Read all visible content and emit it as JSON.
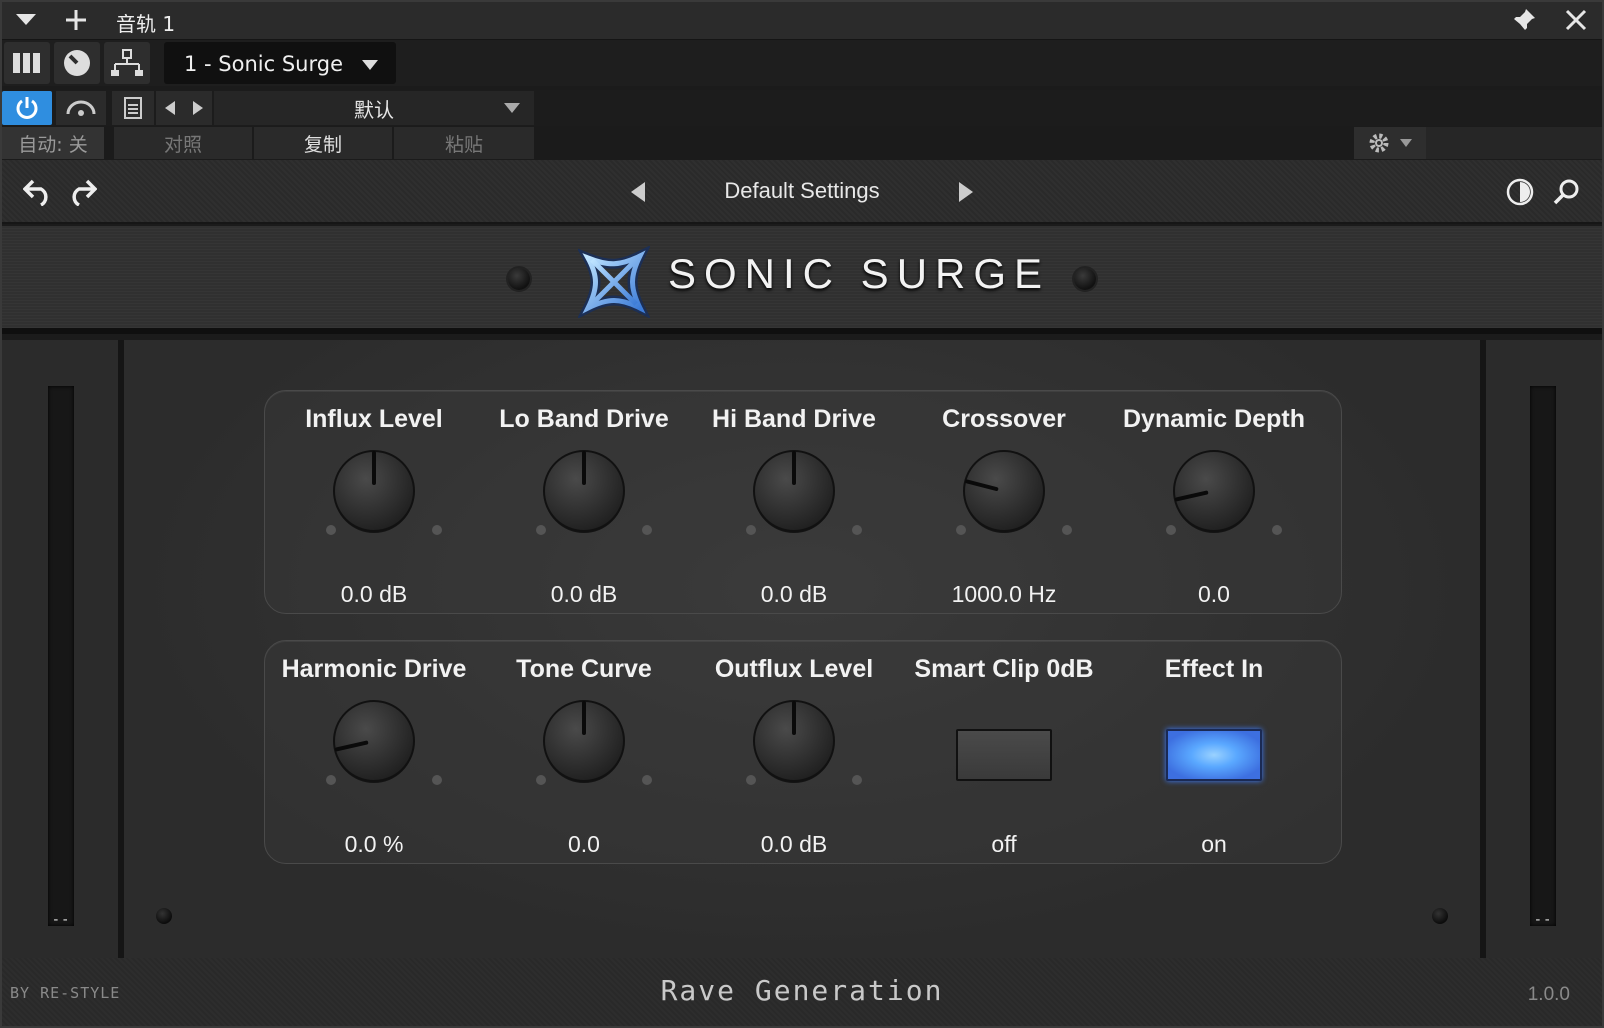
{
  "host": {
    "track_name": "音轨 1",
    "plugin_select": "1 - Sonic Surge",
    "preset_dropdown": "默认",
    "automation": "自动: 关",
    "compare": "对照",
    "copy": "复制",
    "paste": "粘贴"
  },
  "plugin": {
    "preset_name": "Default Settings",
    "title": "SONIC SURGE",
    "row1": [
      {
        "label": "Influx Level",
        "value": "0.0 dB",
        "knob": 0.5
      },
      {
        "label": "Lo Band Drive",
        "value": "0.0 dB",
        "knob": 0.5
      },
      {
        "label": "Hi Band Drive",
        "value": "0.0 dB",
        "knob": 0.5
      },
      {
        "label": "Crossover",
        "value": "1000.0 Hz",
        "knob": 0.22
      },
      {
        "label": "Dynamic Depth",
        "value": "0.0",
        "knob": 0.12
      }
    ],
    "row2": [
      {
        "label": "Harmonic Drive",
        "value": "0.0 %",
        "knob": 0.12
      },
      {
        "label": "Tone Curve",
        "value": "0.0",
        "knob": 0.5
      },
      {
        "label": "Outflux Level",
        "value": "0.0 dB",
        "knob": 0.5
      },
      {
        "label": "Smart Clip 0dB",
        "value": "off",
        "toggle": "off"
      },
      {
        "label": "Effect In",
        "value": "on",
        "toggle": "on"
      }
    ],
    "meter_left_readout": "--",
    "meter_right_readout": "--"
  },
  "footer": {
    "by": "BY RE-STYLE",
    "maker": "Rave Generation",
    "version": "1.0.0"
  },
  "colors": {
    "accent_blue": "#2f8ee0",
    "effect_on": "#5aa8ff"
  }
}
